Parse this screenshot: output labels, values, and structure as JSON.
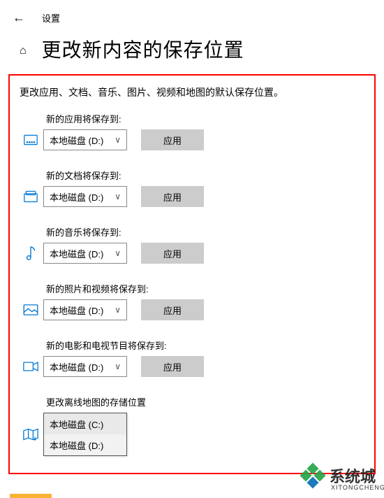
{
  "topbar": {
    "title": "设置"
  },
  "header": {
    "title": "更改新内容的保存位置"
  },
  "subtitle": "更改应用、文档、音乐、图片、视频和地图的默认保存位置。",
  "apply_label": "应用",
  "drive_default": "本地磁盘 (D:)",
  "sections": {
    "apps": {
      "label": "新的应用将保存到:"
    },
    "docs": {
      "label": "新的文档将保存到:"
    },
    "music": {
      "label": "新的音乐将保存到:"
    },
    "photos": {
      "label": "新的照片和视频将保存到:"
    },
    "movies": {
      "label": "新的电影和电视节目将保存到:"
    },
    "maps": {
      "label": "更改离线地图的存储位置"
    }
  },
  "dropdown": {
    "options": {
      "c": "本地磁盘 (C:)",
      "d": "本地磁盘 (D:)"
    }
  },
  "watermark": {
    "text": "系统城",
    "sub": "XITONGCHENG"
  }
}
